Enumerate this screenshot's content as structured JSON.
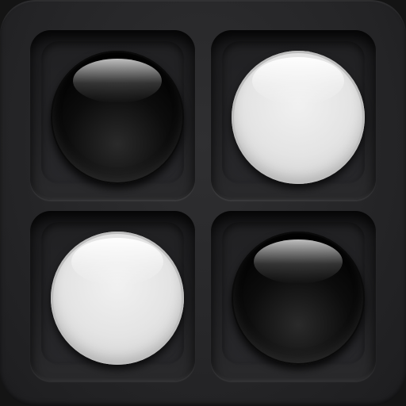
{
  "app": {
    "kind": "board-game-app-icon"
  },
  "board": {
    "rows": 2,
    "cols": 2,
    "cells": [
      {
        "row": 1,
        "col": 1,
        "piece": "black"
      },
      {
        "row": 1,
        "col": 2,
        "piece": "white"
      },
      {
        "row": 2,
        "col": 1,
        "piece": "white"
      },
      {
        "row": 2,
        "col": 2,
        "piece": "black"
      }
    ]
  },
  "colors": {
    "background": "#262628",
    "cell": "#232325",
    "black_piece": "#000000",
    "white_piece": "#e4e4e4"
  }
}
